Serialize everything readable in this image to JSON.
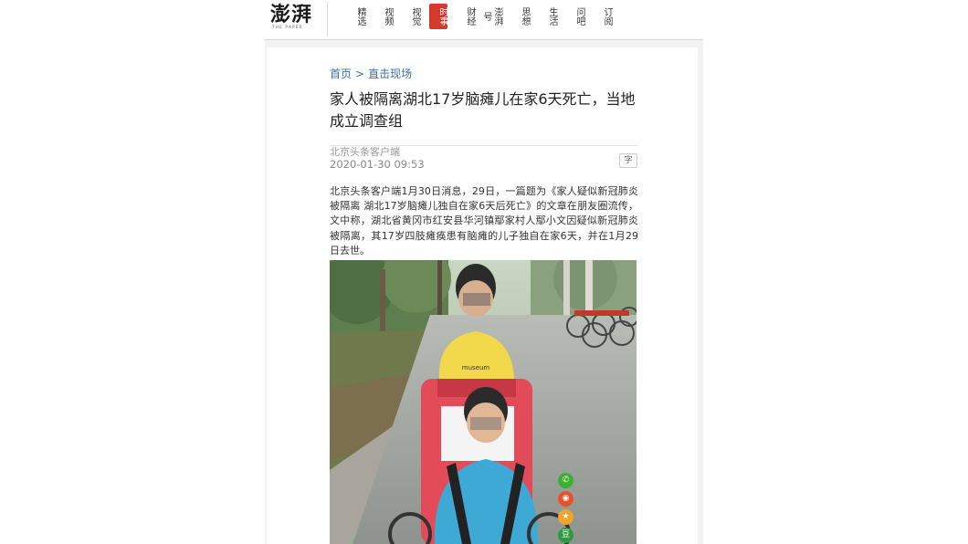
{
  "header": {
    "logo_text": "澎湃",
    "logo_sub": "THE PAPER",
    "nav": [
      {
        "label": "精选",
        "active": false
      },
      {
        "label": "视频",
        "active": false
      },
      {
        "label": "视觉",
        "active": false
      },
      {
        "label": "时事",
        "active": true
      },
      {
        "label": "财经",
        "active": false
      },
      {
        "label": "澎湃号",
        "active": false
      },
      {
        "label": "思想",
        "active": false
      },
      {
        "label": "生活",
        "active": false
      },
      {
        "label": "问吧",
        "active": false
      },
      {
        "label": "订阅",
        "active": false
      }
    ]
  },
  "breadcrumb": {
    "home": "首页",
    "separator": ">",
    "section": "直击现场"
  },
  "article": {
    "title": "家人被隔离湖北17岁脑瘫儿在家6天死亡，当地成立调查组",
    "source": "北京头条客户端",
    "time": "2020-01-30 09:53",
    "font_button": "字",
    "body": "北京头条客户端1月30日消息，29日，一篇题为《家人疑似新冠肺炎被隔离 湖北17岁脑瘫儿独自在家6天后死亡》的文章在朋友圈流传，文中称，湖北省黄冈市红安县华河镇鄢家村人鄢小文因疑似新冠肺炎被隔离，其17岁四肢瘫痪患有脑瘫的儿子独自在家6天，并在1月29日去世。"
  },
  "share": [
    {
      "icon": "wechat-icon",
      "glyph": "✆",
      "color": "#3cb034"
    },
    {
      "icon": "weibo-icon",
      "glyph": "◉",
      "color": "#e6532b"
    },
    {
      "icon": "qzone-icon",
      "glyph": "★",
      "color": "#f3a526"
    },
    {
      "icon": "douban-icon",
      "glyph": "豆",
      "color": "#2f9a3f"
    }
  ],
  "colors": {
    "accent": "#d33a2c",
    "link": "#3b6ea5"
  }
}
